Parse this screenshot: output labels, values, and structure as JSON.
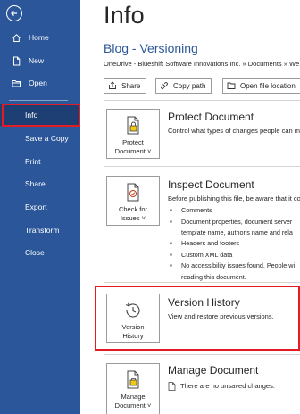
{
  "sidebar": {
    "back_label": "",
    "items": [
      {
        "label": "Home"
      },
      {
        "label": "New"
      },
      {
        "label": "Open"
      },
      {
        "label": "Info"
      },
      {
        "label": "Save a Copy"
      },
      {
        "label": "Print"
      },
      {
        "label": "Share"
      },
      {
        "label": "Export"
      },
      {
        "label": "Transform"
      },
      {
        "label": "Close"
      }
    ],
    "active_item": "Info",
    "highlight_color": "#e41b23",
    "background_color": "#2b579a"
  },
  "main": {
    "title": "Info",
    "doc_name": "Blog - Versioning",
    "doc_path": "OneDrive - Blueshift Software Innovations Inc. » Documents » We",
    "actions": [
      {
        "label": "Share",
        "icon": "share-icon"
      },
      {
        "label": "Copy path",
        "icon": "copy-path-icon"
      },
      {
        "label": "Open file location",
        "icon": "folder-icon"
      }
    ],
    "sections": {
      "protect": {
        "tile_line1": "Protect",
        "tile_line2": "Document ˅",
        "title": "Protect Document",
        "desc": "Control what types of changes people can m",
        "icon": "lock-document-icon"
      },
      "inspect": {
        "tile_line1": "Check for",
        "tile_line2": "Issues ˅",
        "title": "Inspect Document",
        "desc": "Before publishing this file, be aware that it co",
        "bullets": [
          "Comments",
          "Document properties, document server",
          "template name, author's name and rela",
          "Headers and footers",
          "Custom XML data",
          "No accessibility issues found. People wi",
          "reading this document."
        ],
        "icon": "inspect-document-icon"
      },
      "version": {
        "tile_line1": "Version",
        "tile_line2": "History",
        "title": "Version History",
        "desc": "View and restore previous versions.",
        "icon": "history-clock-icon"
      },
      "manage": {
        "tile_line1": "Manage",
        "tile_line2": "Document ˅",
        "title": "Manage Document",
        "desc": "There are no unsaved changes.",
        "icon": "manage-document-icon"
      }
    }
  }
}
